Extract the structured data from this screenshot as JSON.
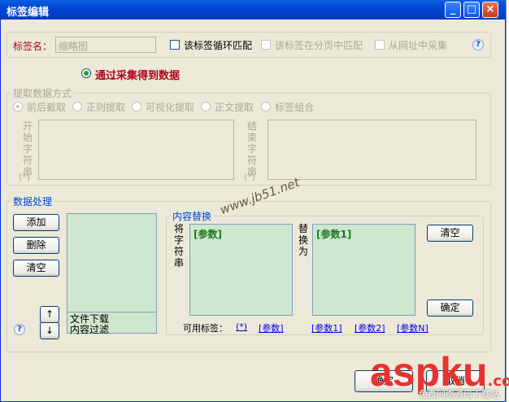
{
  "window": {
    "title": "标签编辑"
  },
  "titlebar_buttons": {
    "minimize": "_",
    "maximize": "□",
    "close": "×"
  },
  "tag": {
    "name_label": "标签名：",
    "name_value": "缩略图",
    "loop_label": "该标签循环匹配",
    "paging_label": "该标签在分页中匹配",
    "url_label": "从网址中采集"
  },
  "collect": {
    "label": "通过采集得到数据"
  },
  "extract": {
    "group_label": "提取数据方式",
    "options": [
      "前后截取",
      "正则提取",
      "可视化提取",
      "正文提取",
      "标签组合"
    ],
    "start_label": "开始字符串",
    "end_label": "结束字符串",
    "wildcard": "(*)"
  },
  "processing": {
    "group_label": "数据处理",
    "add": "添加",
    "delete": "删除",
    "clear": "清空",
    "list_items": [
      "文件下载",
      "内容过滤"
    ],
    "up": "↑",
    "down": "↓"
  },
  "replace": {
    "group_label": "内容替换",
    "find_label": "将字符串",
    "replace_label": "替换为",
    "find_value": "[参数]",
    "replace_value": "[参数1]",
    "clear": "清空",
    "confirm": "确定",
    "available_label": "可用标签：",
    "tags": [
      "(*)",
      "[参数]",
      "[参数1]",
      "[参数2]",
      "[参数N]"
    ]
  },
  "footer": {
    "ok": "确定",
    "cancel": "取消"
  },
  "watermark": {
    "site": "www.jb51.net",
    "brand_a": "asp",
    "brand_b": "ku",
    "brand_c": ".com",
    "tagline": "免费网络源码下载站"
  },
  "help_icon": "?"
}
